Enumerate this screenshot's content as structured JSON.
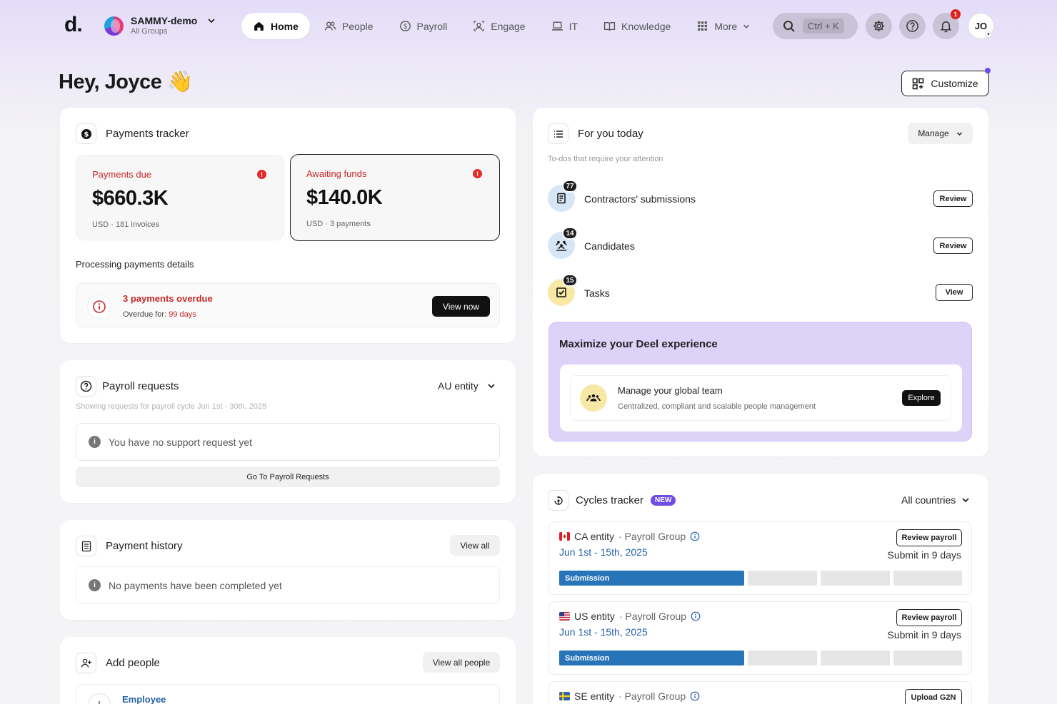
{
  "nav": {
    "logo": "d.",
    "org_name": "SAMMY-demo",
    "org_sub": "All Groups",
    "tabs": [
      {
        "label": "Home",
        "icon": "home-icon",
        "active": true
      },
      {
        "label": "People",
        "icon": "people-icon"
      },
      {
        "label": "Payroll",
        "icon": "dollar-icon"
      },
      {
        "label": "Engage",
        "icon": "engage-icon"
      },
      {
        "label": "IT",
        "icon": "laptop-icon"
      },
      {
        "label": "Knowledge",
        "icon": "book-icon"
      },
      {
        "label": "More",
        "icon": "grid-icon"
      }
    ],
    "search_shortcut": "Ctrl + K",
    "notif_count": "1",
    "user_initials": "JO"
  },
  "header": {
    "greeting": "Hey, Joyce",
    "wave": "👋",
    "customize_label": "Customize"
  },
  "payments": {
    "title": "Payments tracker",
    "due_label": "Payments due",
    "due_value": "$660.3K",
    "due_sub": "USD · 181 invoices",
    "awaiting_label": "Awaiting funds",
    "awaiting_value": "$140.0K",
    "awaiting_sub": "USD · 3 payments",
    "details_title": "Processing payments details",
    "overdue_title": "3 payments overdue",
    "overdue_prefix": "Overdue for: ",
    "overdue_days": "99 days",
    "view_now": "View now"
  },
  "payroll_requests": {
    "title": "Payroll requests",
    "entity": "AU entity",
    "subtitle": "Showing requests for payroll cycle Jun 1st - 30th, 2025",
    "empty": "You have no support request yet",
    "go_btn": "Go To Payroll Requests"
  },
  "payment_history": {
    "title": "Payment history",
    "view_all": "View all",
    "empty": "No payments have been completed yet"
  },
  "add_people": {
    "title": "Add people",
    "view_all": "View all people",
    "first_item": "Employee"
  },
  "for_you": {
    "title": "For you today",
    "manage": "Manage",
    "subtitle": "To-dos that require your attention",
    "items": [
      {
        "label": "Contractors' submissions",
        "count": "77",
        "action": "Review"
      },
      {
        "label": "Candidates",
        "count": "14",
        "action": "Review"
      },
      {
        "label": "Tasks",
        "count": "15",
        "action": "View"
      }
    ]
  },
  "promo": {
    "title": "Maximize your Deel experience",
    "item_title": "Manage your global team",
    "item_sub": "Centralized, compliant and scalable people management",
    "explore": "Explore"
  },
  "cycles": {
    "title": "Cycles tracker",
    "badge": "NEW",
    "filter": "All countries",
    "items": [
      {
        "entity": "CA entity",
        "group": "· Payroll Group",
        "dates": "Jun 1st - 15th, 2025",
        "action": "Review payroll",
        "submit": "Submit in 9 days",
        "stage": "Submission"
      },
      {
        "entity": "US entity",
        "group": "· Payroll Group",
        "dates": "Jun 1st - 15th, 2025",
        "action": "Review payroll",
        "submit": "Submit in 9 days",
        "stage": "Submission"
      },
      {
        "entity": "SE entity",
        "group": "· Payroll Group",
        "action": "Upload G2N"
      }
    ]
  },
  "colors": {
    "accent": "#6f4ce3",
    "danger": "#c62828",
    "stage_blue": "#2774b8",
    "promo_bg": "#ddd3f9"
  }
}
